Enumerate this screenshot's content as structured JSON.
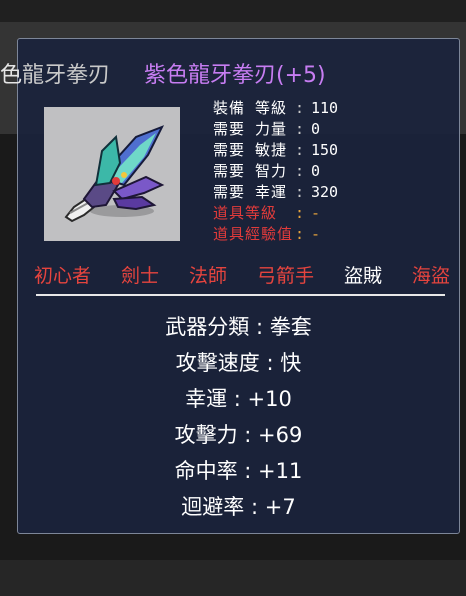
{
  "item": {
    "name_ghost_clip": "色",
    "name_ghost": "龍牙拳刃",
    "name": "紫色龍牙拳刃(+5)"
  },
  "stats": [
    {
      "label": "裝備 等級",
      "sep": ":",
      "value": "110",
      "color": "#ffffff"
    },
    {
      "label": "需要 力量",
      "sep": ":",
      "value": "0",
      "color": "#ffffff"
    },
    {
      "label": "需要 敏捷",
      "sep": ":",
      "value": "150",
      "color": "#ffffff"
    },
    {
      "label": "需要 智力",
      "sep": ":",
      "value": "0",
      "color": "#ffffff"
    },
    {
      "label": "需要 幸運",
      "sep": ":",
      "value": "320",
      "color": "#ffffff"
    },
    {
      "label": "道具等級",
      "sep": ":",
      "value": "-",
      "color": "#e23b3b"
    },
    {
      "label": "道具經驗值",
      "sep": ":",
      "value": "-",
      "color": "#e23b3b"
    }
  ],
  "jobs": [
    {
      "label": "初心者",
      "active": false
    },
    {
      "label": "劍士",
      "active": false
    },
    {
      "label": "法師",
      "active": false
    },
    {
      "label": "弓箭手",
      "active": false
    },
    {
      "label": "盜賊",
      "active": true
    },
    {
      "label": "海盜",
      "active": false
    }
  ],
  "properties": [
    {
      "text": "武器分類 : 拳套"
    },
    {
      "text": "攻擊速度 : 快"
    },
    {
      "text": "幸運 : +10"
    },
    {
      "text": "攻擊力 : +69"
    },
    {
      "text": "命中率 : +11"
    },
    {
      "text": "迴避率 : +7"
    }
  ],
  "colors": {
    "item_name": "#c77df2",
    "job_unavailable": "#e5443e",
    "job_available": "#ffffff",
    "tooltip_bg": "#1b243c"
  },
  "icon": "claw-weapon-icon"
}
